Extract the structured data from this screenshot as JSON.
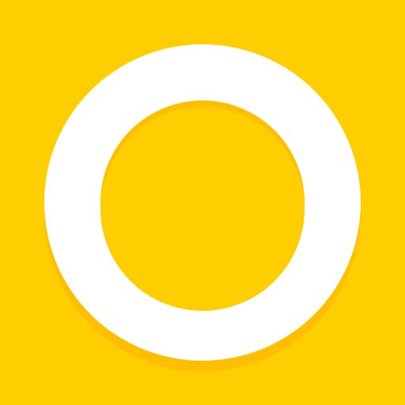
{
  "app_icon": {
    "icon_name": "ring-logo-icon",
    "colors": {
      "background": "#FFCE00",
      "ring": "#FFFFFF",
      "shadow": "#FFBF00"
    }
  }
}
